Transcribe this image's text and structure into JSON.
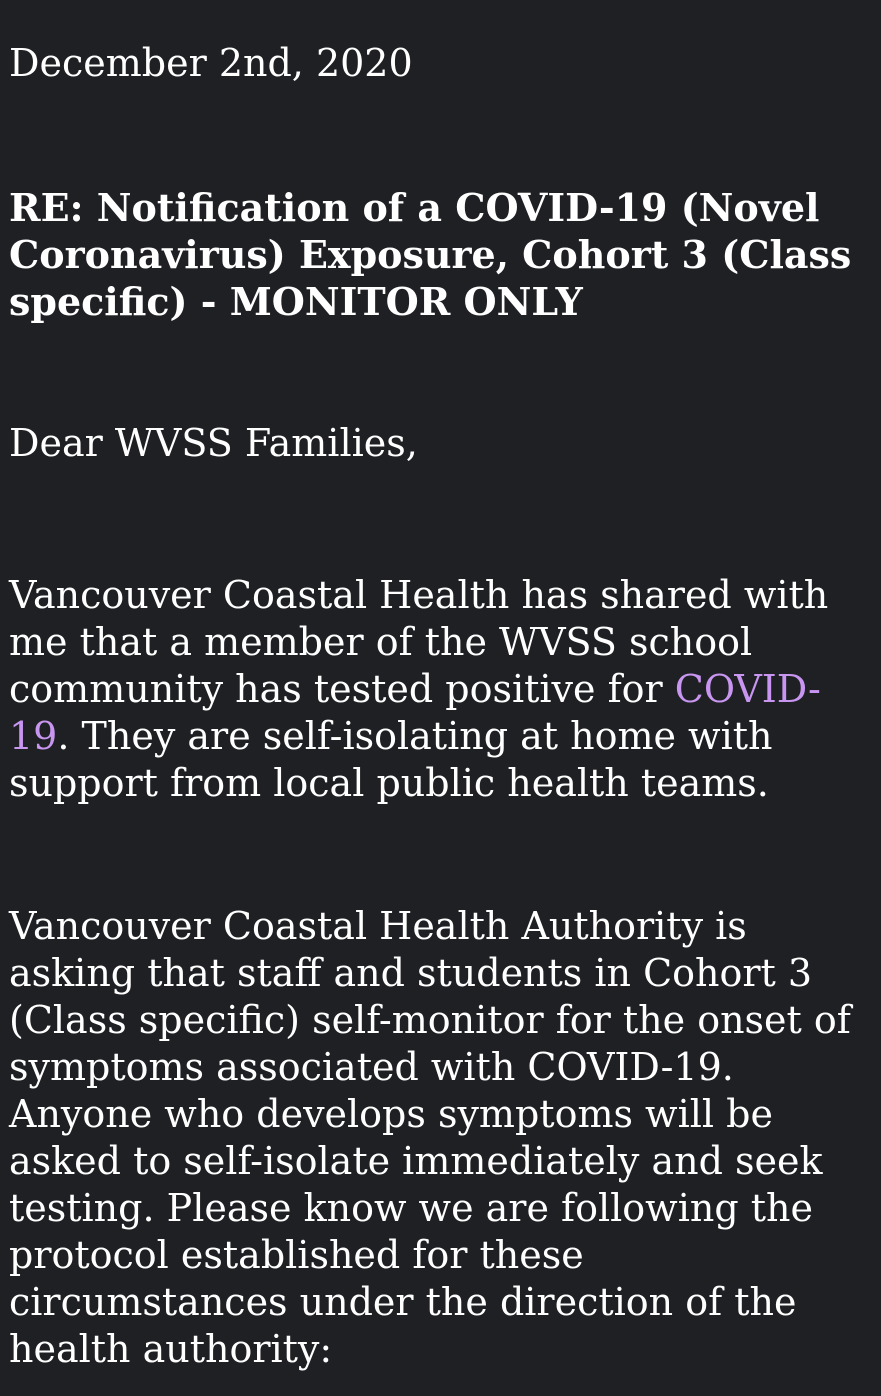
{
  "email": {
    "date": "December 2nd, 2020",
    "subject_lines": [
      "RE:  Notification of a COVID-19 (Novel",
      "Coronavirus) Exposure, Cohort 3 (Class",
      "specific) - MONITOR ONLY"
    ],
    "greeting": "Dear WVSS Families,",
    "paragraph1": {
      "line1": "Vancouver Coastal Health has shared with",
      "line2": "me that a member of the WVSS school",
      "line3_prefix": "community has tested positive for ",
      "link_part1": "COVID-",
      "link_part2": "19",
      "line4_suffix": ". They are self-isolating at home with",
      "line5": "support from local public health teams."
    },
    "paragraph2_lines": [
      "Vancouver Coastal Health Authority is",
      "asking that staff and students in Cohort 3",
      "(Class specific) self-monitor for the onset of",
      "symptoms associated with COVID-19.",
      "Anyone who develops symptoms will be",
      "asked to self-isolate immediately and seek",
      "testing. Please know we are following the",
      "protocol established for these",
      "circumstances under the direction of the",
      "health authority:"
    ],
    "link_color": "#c896f0",
    "background_color": "#1f2024"
  }
}
